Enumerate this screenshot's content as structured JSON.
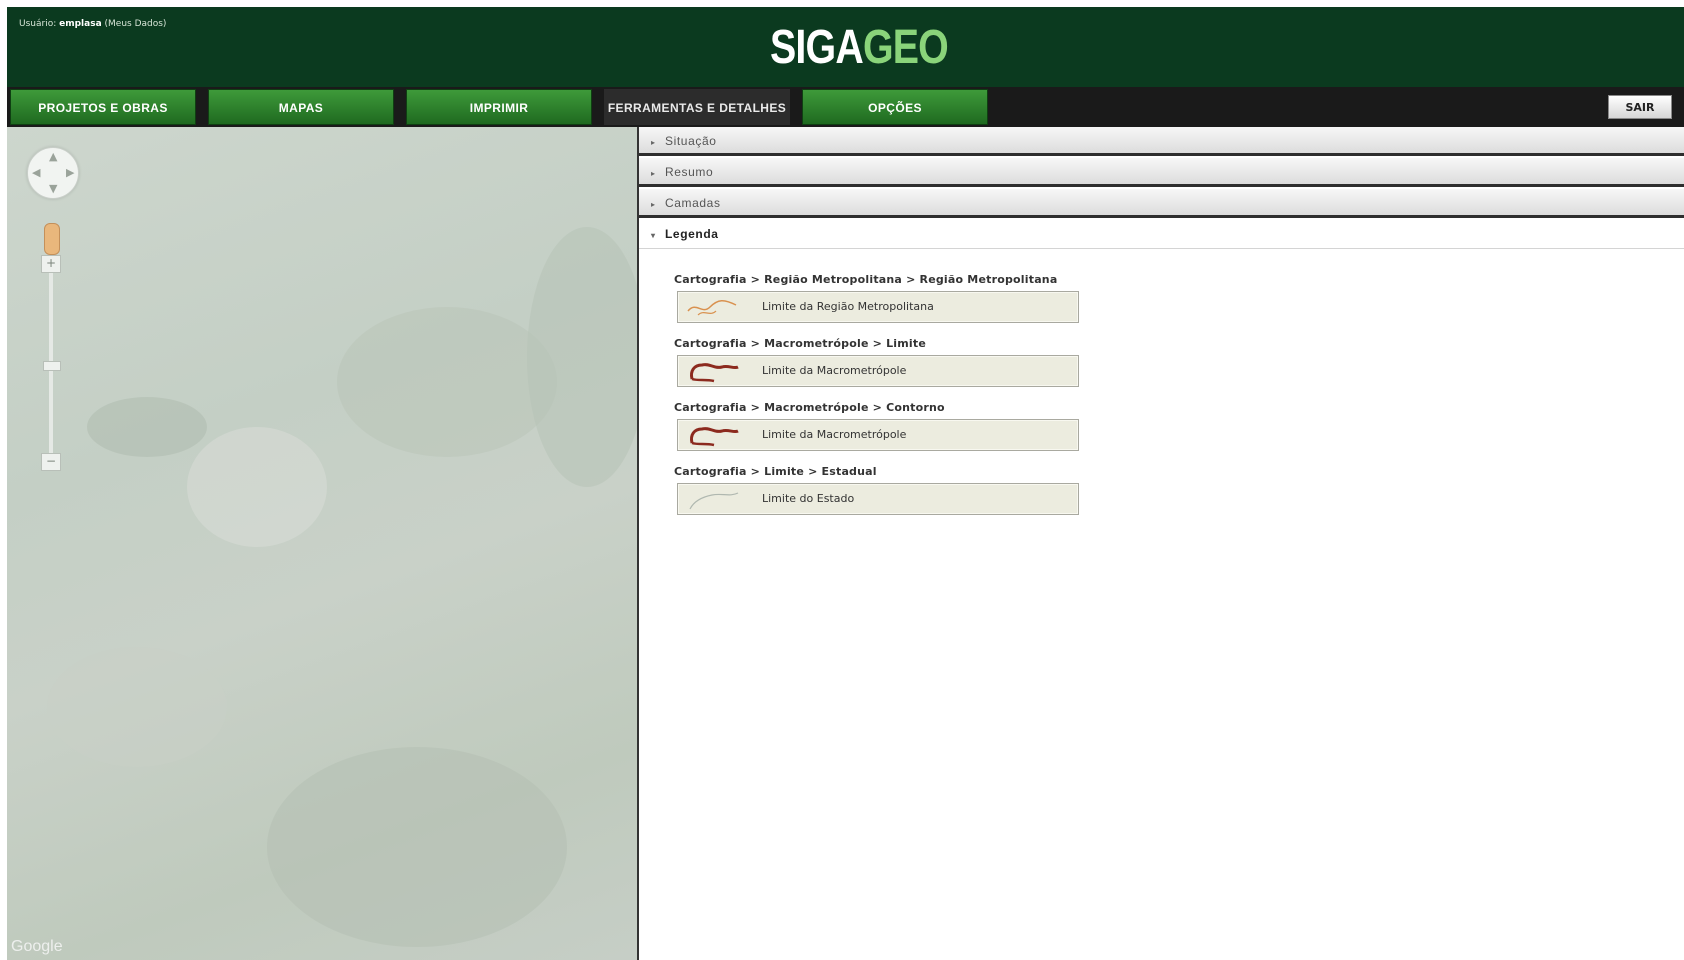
{
  "header": {
    "user_label": "Usuário:",
    "user_name": "emplasa",
    "user_link": "(Meus Dados)",
    "logo_part1": "SIGA",
    "logo_part2": "GEO"
  },
  "nav": {
    "items": [
      {
        "label": "PROJETOS E OBRAS"
      },
      {
        "label": "MAPAS"
      },
      {
        "label": "IMPRIMIR"
      },
      {
        "label": "FERRAMENTAS E DETALHES",
        "active": true
      },
      {
        "label": "OPÇÕES"
      }
    ],
    "exit_label": "SAIR"
  },
  "map": {
    "google_label": "Google",
    "zoom_in": "+",
    "zoom_out": "−"
  },
  "panel": {
    "sections": [
      {
        "label": "Situação",
        "open": false
      },
      {
        "label": "Resumo",
        "open": false
      },
      {
        "label": "Camadas",
        "open": false
      },
      {
        "label": "Legenda",
        "open": true
      }
    ],
    "legend": [
      {
        "title": "Cartografia > Região Metropolitana > Região Metropolitana",
        "label": "Limite da Região Metropolitana",
        "icon": "metro-limit-icon",
        "color": "#d9914f"
      },
      {
        "title": "Cartografia > Macrometrópole > Limite",
        "label": "Limite da Macrometrópole",
        "icon": "macro-limit-icon",
        "color": "#8c2a1e"
      },
      {
        "title": "Cartografia > Macrometrópole > Contorno",
        "label": "Limite da Macrometrópole",
        "icon": "macro-contour-icon",
        "color": "#8c2a1e"
      },
      {
        "title": "Cartografia > Limite > Estadual",
        "label": "Limite do Estado",
        "icon": "state-limit-icon",
        "color": "#b0b8b0"
      }
    ]
  },
  "colors": {
    "header_bg": "#0b3a1f",
    "nav_green": "#2f8a2d",
    "logo_accent": "#8ad47a"
  }
}
